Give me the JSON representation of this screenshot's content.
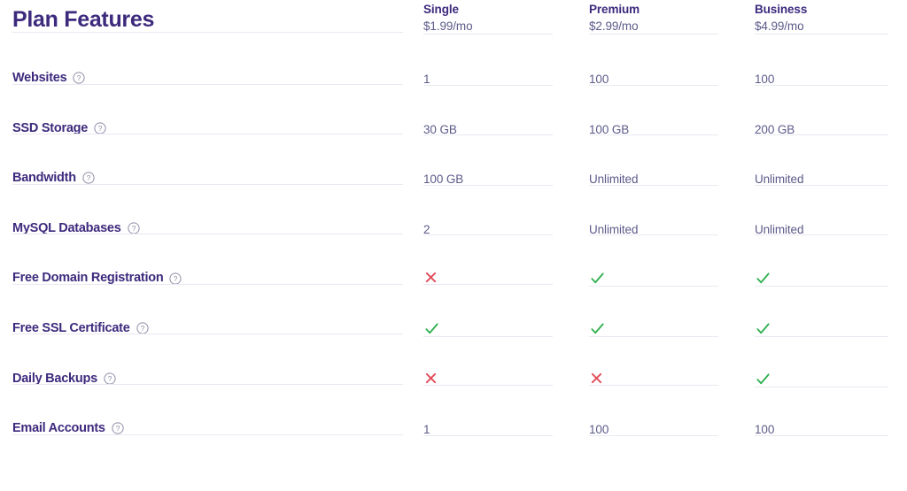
{
  "title": "Plan Features",
  "colors": {
    "heading": "#3d2a7d",
    "value_text": "#5c5b8a",
    "divider": "#e9e9f2",
    "check_green": "#2eaf4e",
    "cross_red": "#e14a5a",
    "help_icon": "#8b8ba5",
    "background": "#ffffff"
  },
  "plans": [
    {
      "name": "Single",
      "price": "$1.99/mo"
    },
    {
      "name": "Premium",
      "price": "$2.99/mo"
    },
    {
      "name": "Business",
      "price": "$4.99/mo"
    }
  ],
  "help_icon_name": "help-circle-icon",
  "features": [
    {
      "label": "Websites",
      "values": [
        {
          "type": "text",
          "text": "1"
        },
        {
          "type": "text",
          "text": "100"
        },
        {
          "type": "text",
          "text": "100"
        }
      ]
    },
    {
      "label": "SSD Storage",
      "values": [
        {
          "type": "text",
          "text": "30 GB"
        },
        {
          "type": "text",
          "text": "100 GB"
        },
        {
          "type": "text",
          "text": "200 GB"
        }
      ]
    },
    {
      "label": "Bandwidth",
      "values": [
        {
          "type": "text",
          "text": "100 GB"
        },
        {
          "type": "text",
          "text": "Unlimited"
        },
        {
          "type": "text",
          "text": "Unlimited"
        }
      ]
    },
    {
      "label": "MySQL Databases",
      "values": [
        {
          "type": "text",
          "text": "2"
        },
        {
          "type": "text",
          "text": "Unlimited"
        },
        {
          "type": "text",
          "text": "Unlimited"
        }
      ]
    },
    {
      "label": "Free Domain Registration",
      "values": [
        {
          "type": "cross",
          "text": ""
        },
        {
          "type": "check",
          "text": ""
        },
        {
          "type": "check",
          "text": ""
        }
      ]
    },
    {
      "label": "Free SSL Certificate",
      "values": [
        {
          "type": "check",
          "text": ""
        },
        {
          "type": "check",
          "text": ""
        },
        {
          "type": "check",
          "text": ""
        }
      ]
    },
    {
      "label": "Daily Backups",
      "values": [
        {
          "type": "cross",
          "text": ""
        },
        {
          "type": "cross",
          "text": ""
        },
        {
          "type": "check",
          "text": ""
        }
      ]
    },
    {
      "label": "Email Accounts",
      "values": [
        {
          "type": "text",
          "text": "1"
        },
        {
          "type": "text",
          "text": "100"
        },
        {
          "type": "text",
          "text": "100"
        }
      ]
    }
  ]
}
